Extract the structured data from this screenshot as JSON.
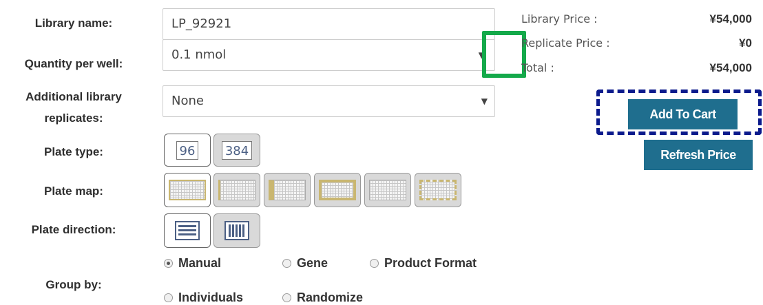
{
  "form": {
    "library_name_label": "Library name:",
    "library_name_value": "LP_92921",
    "quantity_label": "Quantity per well:",
    "quantity_value": "0.1 nmol",
    "replicates_label_line1": "Additional library",
    "replicates_label_line2": "replicates:",
    "replicates_value": "None",
    "plate_type_label": "Plate type:",
    "plate_type_options": [
      "96",
      "384"
    ],
    "plate_type_selected": "96",
    "plate_map_label": "Plate map:",
    "plate_map_options_count": 6,
    "plate_direction_label": "Plate direction:",
    "plate_direction_options": [
      "horizontal-lines-icon",
      "vertical-lines-icon"
    ],
    "group_by_label": "Group by:",
    "group_by_options": [
      "Manual",
      "Gene",
      "Product Format",
      "Individuals",
      "Randomize"
    ],
    "group_by_selected": "Manual",
    "dropdown_caret": "▼"
  },
  "pricing": {
    "library_price_label": "Library Price :",
    "library_price_value": "¥54,000",
    "replicate_price_label": "Replicate Price :",
    "replicate_price_value": "¥0",
    "total_label": "Total :",
    "total_value": "¥54,000"
  },
  "actions": {
    "add_to_cart": "Add To Cart",
    "refresh_price": "Refresh Price"
  },
  "colors": {
    "button_bg": "#1f6e8e",
    "highlight_green": "#14a94a",
    "highlight_navy": "#0b1a8c",
    "plate_map_accent": "#c9b670"
  }
}
